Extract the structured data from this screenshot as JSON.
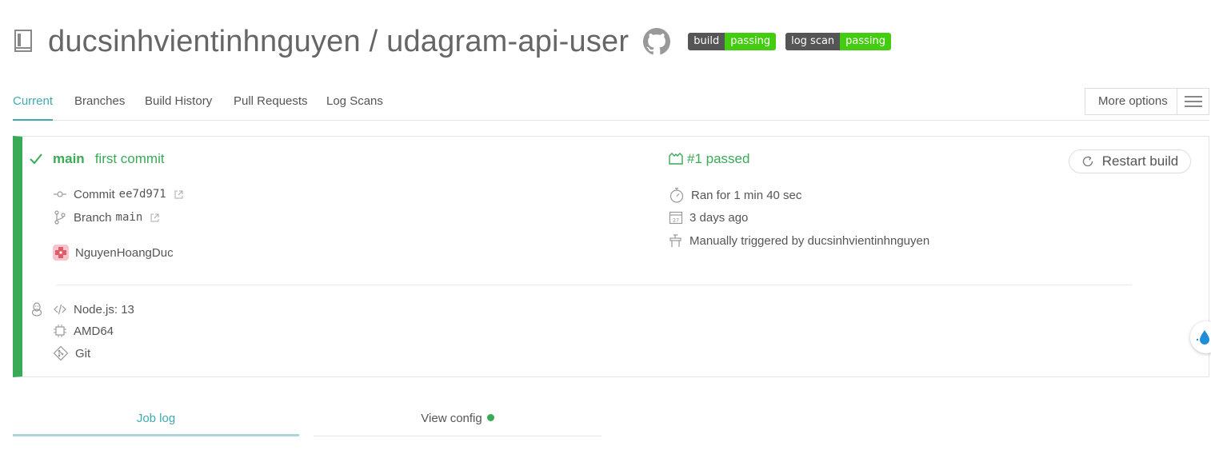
{
  "header": {
    "owner": "ducsinhvientinhnguyen",
    "separator": "/",
    "repo": "udagram-api-user",
    "badges": [
      {
        "label": "build",
        "value": "passing"
      },
      {
        "label": "log scan",
        "value": "passing"
      }
    ]
  },
  "tabs": [
    {
      "label": "Current",
      "active": true
    },
    {
      "label": "Branches"
    },
    {
      "label": "Build History"
    },
    {
      "label": "Pull Requests"
    },
    {
      "label": "Log Scans"
    }
  ],
  "more_options": "More options",
  "build": {
    "branch": "main",
    "message": "first commit",
    "status": "#1 passed",
    "restart": "Restart build",
    "commit_label": "Commit",
    "commit_sha": "ee7d971",
    "branch_label": "Branch",
    "branch_name": "main",
    "author": "NguyenHoangDuc",
    "duration": "Ran for 1 min 40 sec",
    "when": "3 days ago",
    "trigger": "Manually triggered by ducsinhvientinhnguyen",
    "language": "Node.js: 13",
    "arch": "AMD64",
    "vcs": "Git"
  },
  "bottom_tabs": {
    "job_log": "Job log",
    "view_config": "View config"
  },
  "colors": {
    "accent": "#3eaaaf",
    "passed": "#39aa56",
    "badge_pass": "#44cc11"
  }
}
